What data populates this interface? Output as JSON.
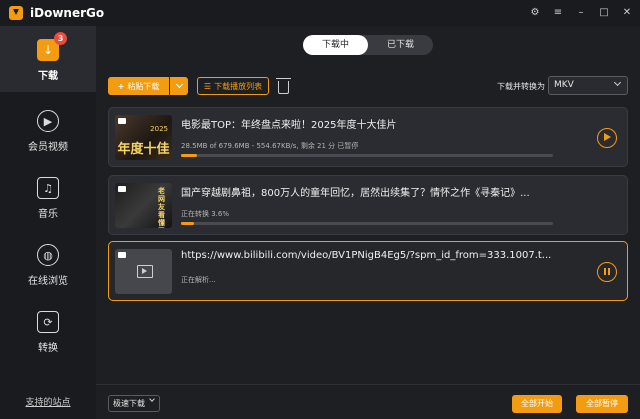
{
  "app": {
    "title": "iDownerGo"
  },
  "sidebar": {
    "items": [
      {
        "label": "下载",
        "badge": "3"
      },
      {
        "label": "会员视频"
      },
      {
        "label": "音乐"
      },
      {
        "label": "在线浏览"
      },
      {
        "label": "转换"
      }
    ],
    "support_link": "支持的站点"
  },
  "tabs": [
    {
      "label": "下载中",
      "active": true
    },
    {
      "label": "已下载",
      "active": false
    }
  ],
  "toolbar": {
    "paste_label": "粘贴下载",
    "playlist_label": "下载播放列表",
    "convert_label": "下载并转换为",
    "convert_value": "MKV"
  },
  "downloads": [
    {
      "title": "电影最TOP：年终盘点来啦！2025年度十大佳片",
      "status": "28.5MB of 679.6MB - 554.67KB/s, 剩余 21 分 已暂停",
      "thumb_text": "年度十佳",
      "thumb_badge": "2025",
      "progress": 0.042,
      "state": "paused"
    },
    {
      "title": "国产穿越剧鼻祖，800万人的童年回忆，居然出续集了？情怀之作《寻秦记》...",
      "status": "正在转换 3.6%",
      "thumb_text": "",
      "thumb_side": "老网友看懂了",
      "progress": 0.036,
      "state": "converting"
    },
    {
      "title": "https://www.bilibili.com/video/BV1PNigB4Eg5/?spm_id_from=333.1007.t...",
      "status": "正在解析...",
      "progress": 0,
      "state": "parsing"
    }
  ],
  "footer": {
    "speed_value": "极速下载",
    "start_all": "全部开始",
    "pause_all": "全部暂停"
  },
  "colors": {
    "accent": "#f39c12",
    "background": "#1e1f22",
    "sidebar": "#1a1b1e"
  }
}
